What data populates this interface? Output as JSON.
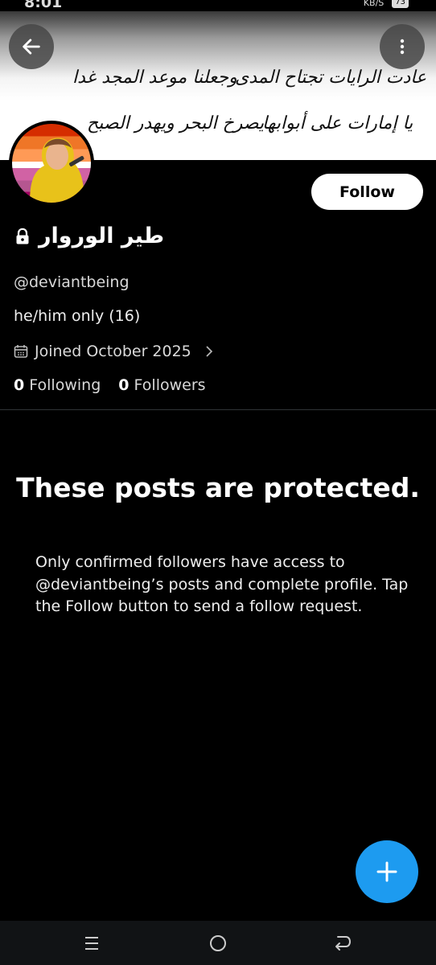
{
  "status_bar": {
    "time": "8:01",
    "speed": "KB/S",
    "battery": "73"
  },
  "banner": {
    "line1_right": "عادت الرايات تجتاح المدى",
    "line1_left": "وجعلنا موعد المجد غدا",
    "line2_right": "يا إمارات على أبوابها",
    "line2_left": "يصرخ البحر ويهدر الصبح"
  },
  "profile": {
    "display_name": "طير الوروار",
    "handle": "@deviantbeing",
    "bio": "he/him only (16)",
    "joined": "Joined October 2025",
    "following_count": "0",
    "following_label": "Following",
    "followers_count": "0",
    "followers_label": "Followers"
  },
  "buttons": {
    "follow_label": "Follow"
  },
  "protected": {
    "title": "These posts are protected.",
    "body": "Only confirmed followers have access to @deviantbeing’s posts and complete profile. Tap the Follow button to send a follow request."
  },
  "icons": {
    "back": "arrow-left-icon",
    "more": "more-vertical-icon",
    "lock": "lock-icon",
    "calendar": "calendar-icon",
    "chevron": "chevron-right-icon",
    "fab": "plus-icon"
  },
  "colors": {
    "accent": "#1d9bf0",
    "background": "#000000"
  }
}
